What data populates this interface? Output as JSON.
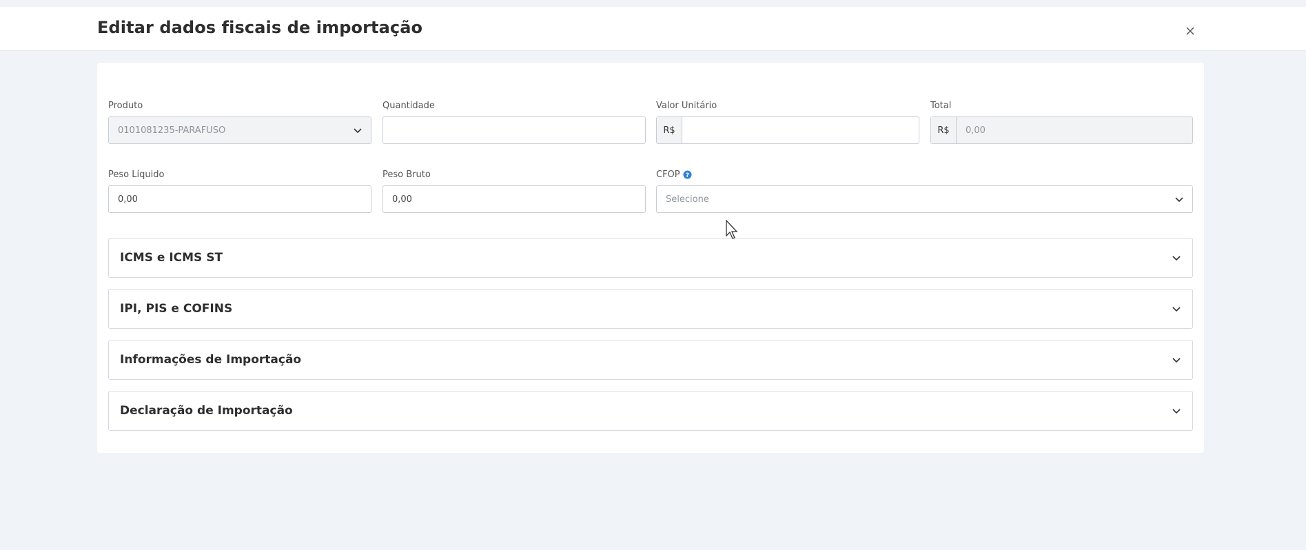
{
  "header": {
    "title": "Editar dados fiscais de importação",
    "close_icon": "close-icon"
  },
  "form": {
    "produto": {
      "label": "Produto",
      "value": "0101081235-PARAFUSO"
    },
    "quantidade": {
      "label": "Quantidade",
      "value": ""
    },
    "valor_unitario": {
      "label": "Valor Unitário",
      "prefix": "R$",
      "value": ""
    },
    "total": {
      "label": "Total",
      "prefix": "R$",
      "value": "0,00"
    },
    "peso_liquido": {
      "label": "Peso Líquido",
      "value": "0,00"
    },
    "peso_bruto": {
      "label": "Peso Bruto",
      "value": "0,00"
    },
    "cfop": {
      "label": "CFOP",
      "placeholder": "Selecione",
      "help_icon": "help-circle-icon"
    }
  },
  "sections": [
    {
      "title": "ICMS e ICMS ST"
    },
    {
      "title": "IPI, PIS e COFINS"
    },
    {
      "title": "Informações de Importação"
    },
    {
      "title": "Declaração de Importação"
    }
  ],
  "colors": {
    "background": "#f0f3f7",
    "card": "#ffffff",
    "border": "#c9ced6",
    "help_icon": "#2f7fd8"
  }
}
